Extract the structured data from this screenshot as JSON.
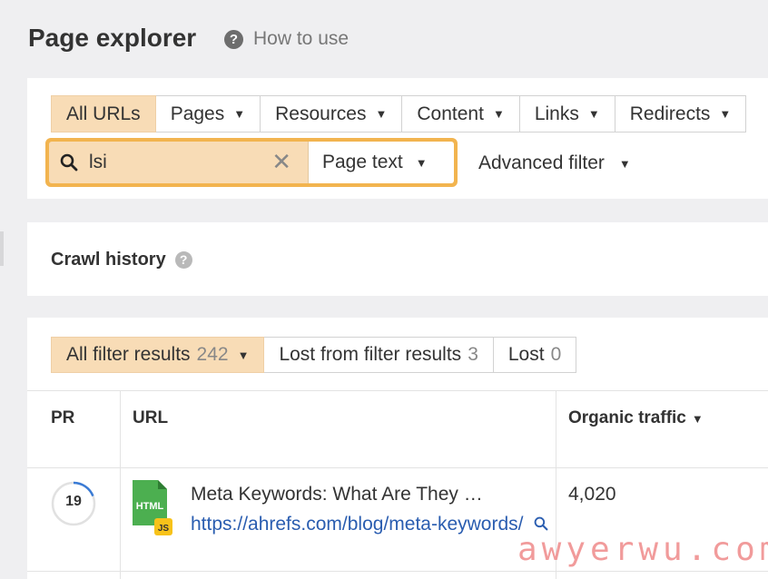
{
  "header": {
    "title": "Page explorer",
    "help_glyph": "?",
    "how_to_use": "How to use"
  },
  "type_tabs": [
    {
      "label": "All URLs",
      "active": true,
      "has_caret": false
    },
    {
      "label": "Pages",
      "active": false,
      "has_caret": true
    },
    {
      "label": "Resources",
      "active": false,
      "has_caret": true
    },
    {
      "label": "Content",
      "active": false,
      "has_caret": true
    },
    {
      "label": "Links",
      "active": false,
      "has_caret": true
    },
    {
      "label": "Redirects",
      "active": false,
      "has_caret": true
    }
  ],
  "search": {
    "value": "lsi",
    "clear_glyph": "✕",
    "scope": "Page text"
  },
  "advanced_filter": "Advanced filter",
  "crawl_history": {
    "title": "Crawl history",
    "help_glyph": "?"
  },
  "filter_tabs": [
    {
      "label": "All filter results",
      "count": "242",
      "active": true,
      "has_caret": true
    },
    {
      "label": "Lost from filter results",
      "count": "3",
      "active": false,
      "has_caret": false
    },
    {
      "label": "Lost",
      "count": "0",
      "active": false,
      "has_caret": false
    }
  ],
  "table": {
    "headers": {
      "pr": "PR",
      "url": "URL",
      "traffic": "Organic traffic",
      "sort_glyph": "▼"
    },
    "rows": [
      {
        "pr": "19",
        "pr_progress": 0.19,
        "file_badge": "HTML",
        "sub_badge": "JS",
        "title": "Meta Keywords: What Are They …",
        "url": "https://ahrefs.com/blog/meta-keywords/",
        "traffic": "4,020"
      }
    ]
  },
  "watermark": "awyerwu.com",
  "colors": {
    "active_tab": "#f8dcb6",
    "highlight_border": "#f2b44f",
    "link": "#2a5db0",
    "progress": "#3a7bd5",
    "html_icon": "#4caf50",
    "js_badge": "#f7c21a"
  }
}
